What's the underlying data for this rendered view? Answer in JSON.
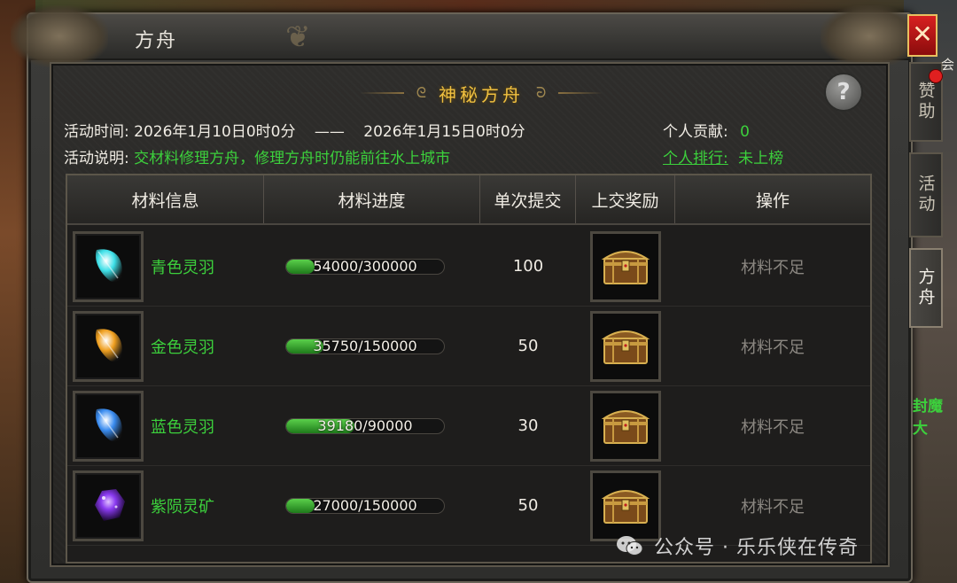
{
  "window": {
    "title": "方舟",
    "close_glyph": "✕"
  },
  "panel": {
    "title": "神秘方舟",
    "help_glyph": "?"
  },
  "info": {
    "time_label": "活动时间:",
    "time_start": "2026年1月10日0时0分",
    "time_sep": "——",
    "time_end": "2026年1月15日0时0分",
    "desc_label": "活动说明:",
    "desc_value": "交材料修理方舟，修理方舟时仍能前往水上城市",
    "contribution_label": "个人贡献:",
    "contribution_value": "0",
    "rank_label": "个人排行:",
    "rank_value": "未上榜"
  },
  "table": {
    "headers": [
      "材料信息",
      "材料进度",
      "单次提交",
      "上交奖励",
      "操作"
    ],
    "rows": [
      {
        "name": "青色灵羽",
        "icon": "cyan-feather-icon",
        "progress_text": "54000/300000",
        "progress": 0.18,
        "qty": "100",
        "reward_icon": "treasure-chest-icon",
        "action": "材料不足",
        "color": "#3ee0e8"
      },
      {
        "name": "金色灵羽",
        "icon": "gold-feather-icon",
        "progress_text": "35750/150000",
        "progress": 0.2383,
        "qty": "50",
        "reward_icon": "treasure-chest-icon",
        "action": "材料不足",
        "color": "#f0a020"
      },
      {
        "name": "蓝色灵羽",
        "icon": "blue-feather-icon",
        "progress_text": "39180/90000",
        "progress": 0.4353,
        "qty": "30",
        "reward_icon": "treasure-chest-icon",
        "action": "材料不足",
        "color": "#3a8cf0"
      },
      {
        "name": "紫陨灵矿",
        "icon": "purple-ore-icon",
        "progress_text": "27000/150000",
        "progress": 0.18,
        "qty": "50",
        "reward_icon": "treasure-chest-icon",
        "action": "材料不足",
        "color": "#8a3af0"
      }
    ]
  },
  "side_tabs": [
    {
      "label": "赞助",
      "active": false
    },
    {
      "label": "活动",
      "active": false
    },
    {
      "label": "方舟",
      "active": true
    }
  ],
  "background": {
    "hui_text": "会",
    "fengmo_text": "封魔大"
  },
  "watermark": {
    "text": "公众号 · 乐乐侠在传奇"
  }
}
